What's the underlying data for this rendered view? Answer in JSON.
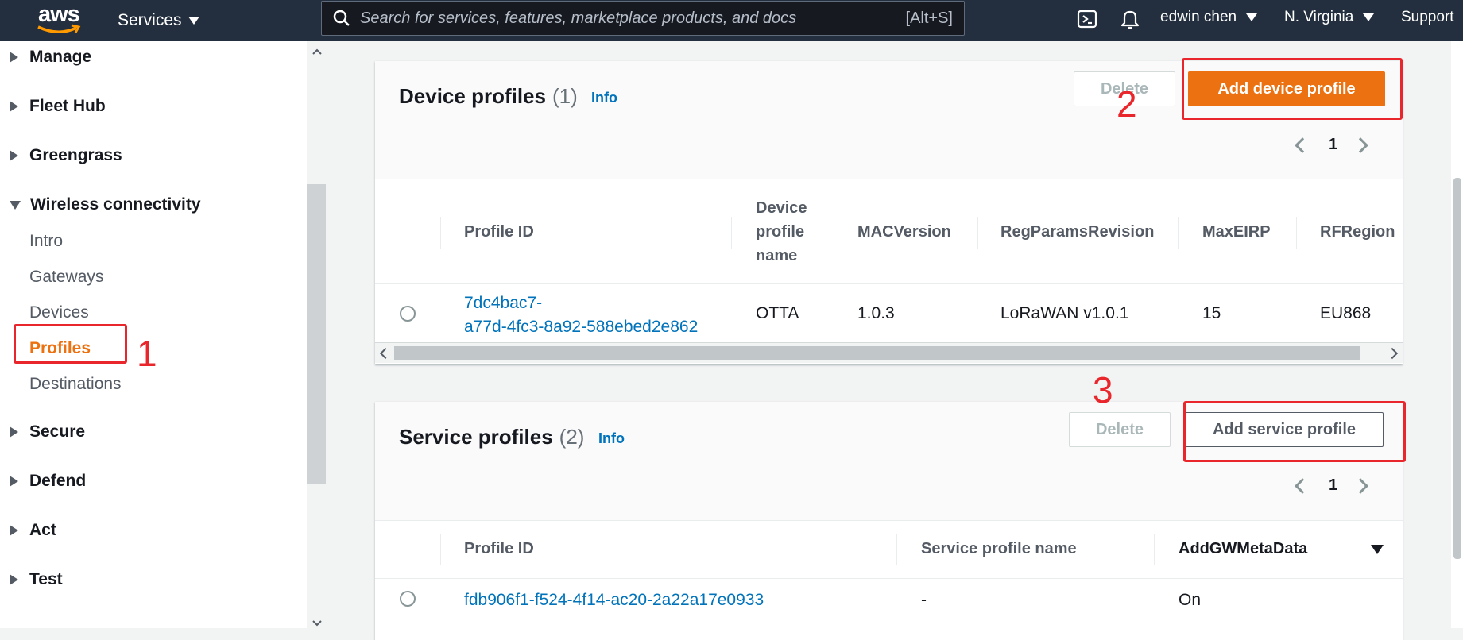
{
  "topnav": {
    "logo_text": "aws",
    "services_label": "Services",
    "search_placeholder": "Search for services, features, marketplace products, and docs",
    "search_shortcut": "[Alt+S]",
    "user": "edwin chen",
    "region": "N. Virginia",
    "support": "Support",
    "icons": [
      "cloudshell-icon",
      "bell-icon"
    ]
  },
  "sidebar": {
    "items": [
      {
        "label": "Manage",
        "expanded": false
      },
      {
        "label": "Fleet Hub",
        "expanded": false
      },
      {
        "label": "Greengrass",
        "expanded": false
      },
      {
        "label": "Wireless connectivity",
        "expanded": true
      },
      {
        "label": "Secure",
        "expanded": false
      },
      {
        "label": "Defend",
        "expanded": false
      },
      {
        "label": "Act",
        "expanded": false
      },
      {
        "label": "Test",
        "expanded": false
      }
    ],
    "subitems": [
      "Intro",
      "Gateways",
      "Devices",
      "Profiles",
      "Destinations"
    ],
    "active_subitem": "Profiles"
  },
  "annotations": [
    "1",
    "2",
    "3"
  ],
  "device_profiles": {
    "title": "Device profiles",
    "count": "(1)",
    "info": "Info",
    "delete_label": "Delete",
    "add_label": "Add device profile",
    "page": "1",
    "columns": [
      "Profile ID",
      "Device profile name",
      "MACVersion",
      "RegParamsRevision",
      "MaxEIRP",
      "RFRegion"
    ],
    "column_lines": {
      "name": [
        "Device",
        "profile",
        "name"
      ]
    },
    "rows": [
      {
        "id_line1": "7dc4bac7-",
        "id_line2": "a77d-4fc3-8a92-588ebed2e862",
        "name": "OTTA",
        "mac": "1.0.3",
        "reg": "LoRaWAN v1.0.1",
        "eirp": "15",
        "rf": "EU868"
      }
    ]
  },
  "service_profiles": {
    "title": "Service profiles",
    "count": "(2)",
    "info": "Info",
    "delete_label": "Delete",
    "add_label": "Add service profile",
    "page": "1",
    "columns": [
      "Profile ID",
      "Service profile name",
      "AddGWMetaData"
    ],
    "rows": [
      {
        "id": "fdb906f1-f524-4f14-ac20-2a22a17e0933",
        "name": "-",
        "meta": "On"
      }
    ]
  },
  "colors": {
    "accent": "#ec7211",
    "link": "#0073bb",
    "nav_bg": "#232f3e",
    "annotation": "#e8262b"
  }
}
